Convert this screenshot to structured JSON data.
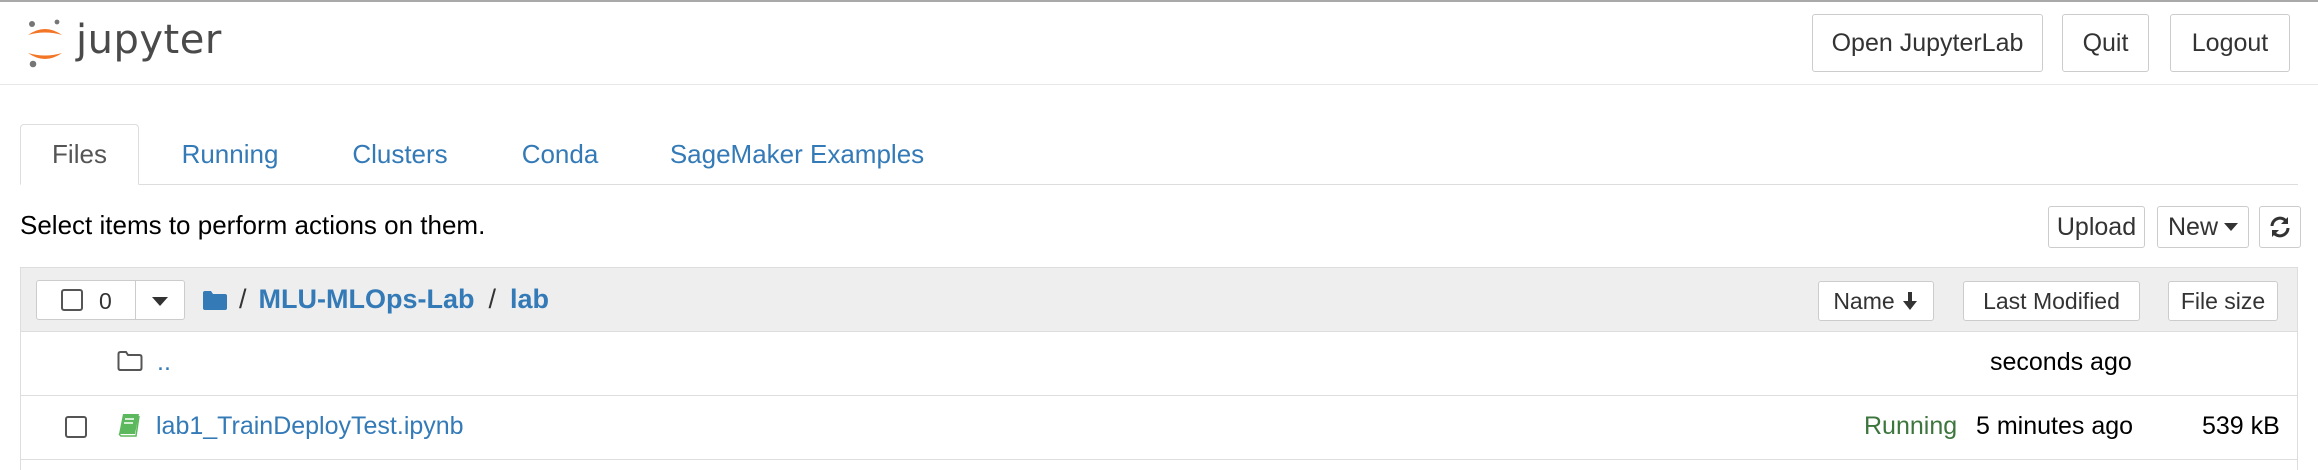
{
  "header": {
    "logo_text": "jupyter",
    "buttons": {
      "open_jupyterlab": "Open JupyterLab",
      "quit": "Quit",
      "logout": "Logout"
    }
  },
  "tabs": [
    {
      "label": "Files",
      "active": true
    },
    {
      "label": "Running",
      "active": false
    },
    {
      "label": "Clusters",
      "active": false
    },
    {
      "label": "Conda",
      "active": false
    },
    {
      "label": "SageMaker Examples",
      "active": false
    }
  ],
  "toolbar": {
    "instructions": "Select items to perform actions on them.",
    "upload_label": "Upload",
    "new_label": "New",
    "refresh_icon": "refresh-icon"
  },
  "file_list": {
    "selected_count": "0",
    "breadcrumb": {
      "root_separator": "/",
      "items": [
        "MLU-MLOps-Lab",
        "lab"
      ],
      "separator": "/"
    },
    "columns": {
      "name": "Name",
      "last_modified": "Last Modified",
      "file_size": "File size"
    },
    "rows": [
      {
        "icon": "folder-icon",
        "name": "..",
        "status": "",
        "modified": "seconds ago",
        "size": ""
      },
      {
        "icon": "notebook-icon",
        "name": "lab1_TrainDeployTest.ipynb",
        "status": "Running",
        "modified": "5 minutes ago",
        "size": "539 kB"
      }
    ]
  },
  "colors": {
    "link": "#337ab7",
    "running": "#3c763d",
    "logo_orange": "#f37626",
    "notebook_green": "#5cb85c"
  }
}
